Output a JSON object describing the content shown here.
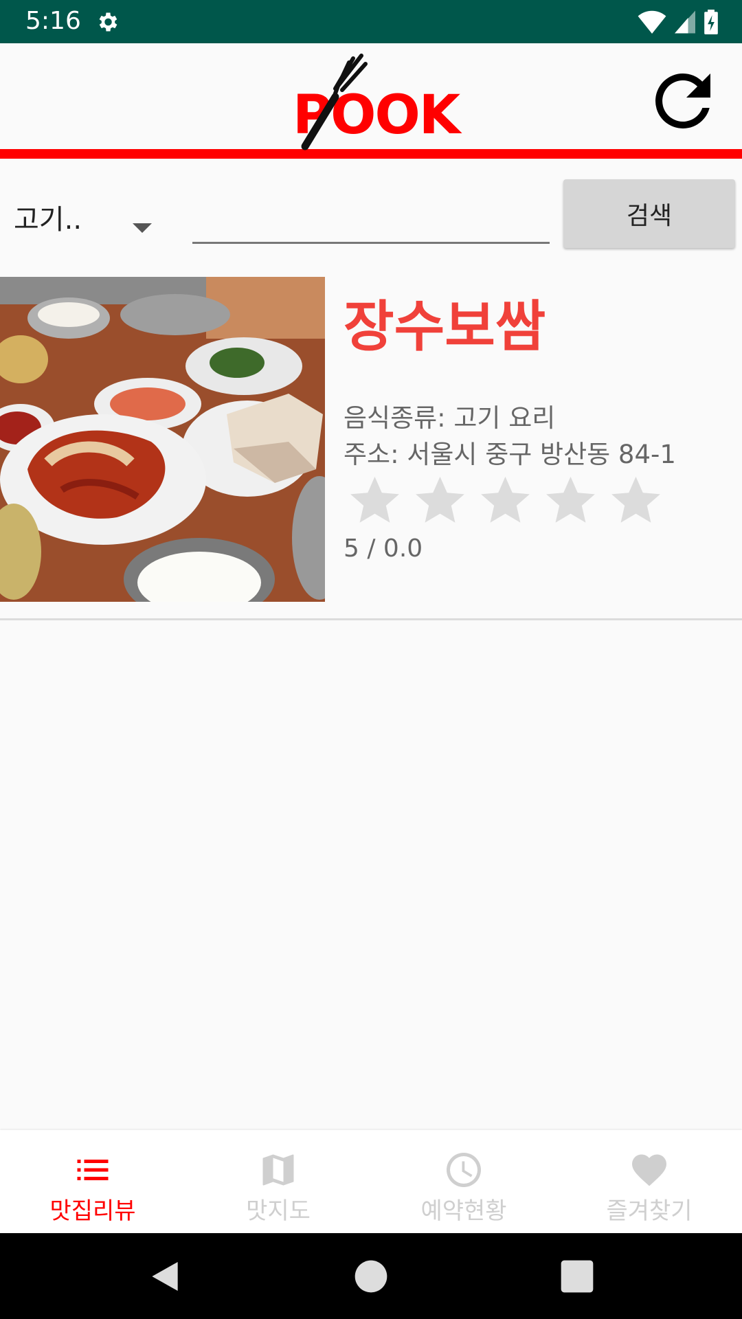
{
  "status_bar": {
    "time": "5:16"
  },
  "app_bar": {
    "logo_text": "POOK"
  },
  "search": {
    "category_selected": "고기..",
    "input_value": "",
    "button_label": "검색"
  },
  "restaurant": {
    "name": "장수보쌈",
    "food_type": "음식종류: 고기 요리",
    "address": "주소: 서울시 중구 방산동 84-1",
    "rating_max": 5,
    "rating_value": 0.0,
    "rating_text": "5 / 0.0"
  },
  "bottom_nav": {
    "items": [
      {
        "label": "맛집리뷰",
        "icon": "list-icon",
        "active": true
      },
      {
        "label": "맛지도",
        "icon": "map-icon",
        "active": false
      },
      {
        "label": "예약현황",
        "icon": "clock-icon",
        "active": false
      },
      {
        "label": "즐겨찾기",
        "icon": "heart-icon",
        "active": false
      }
    ]
  },
  "colors": {
    "status_bar": "#00574b",
    "accent_red": "#ff0000",
    "title_red": "#f0413a",
    "inactive_gray": "#cfcfcf"
  }
}
